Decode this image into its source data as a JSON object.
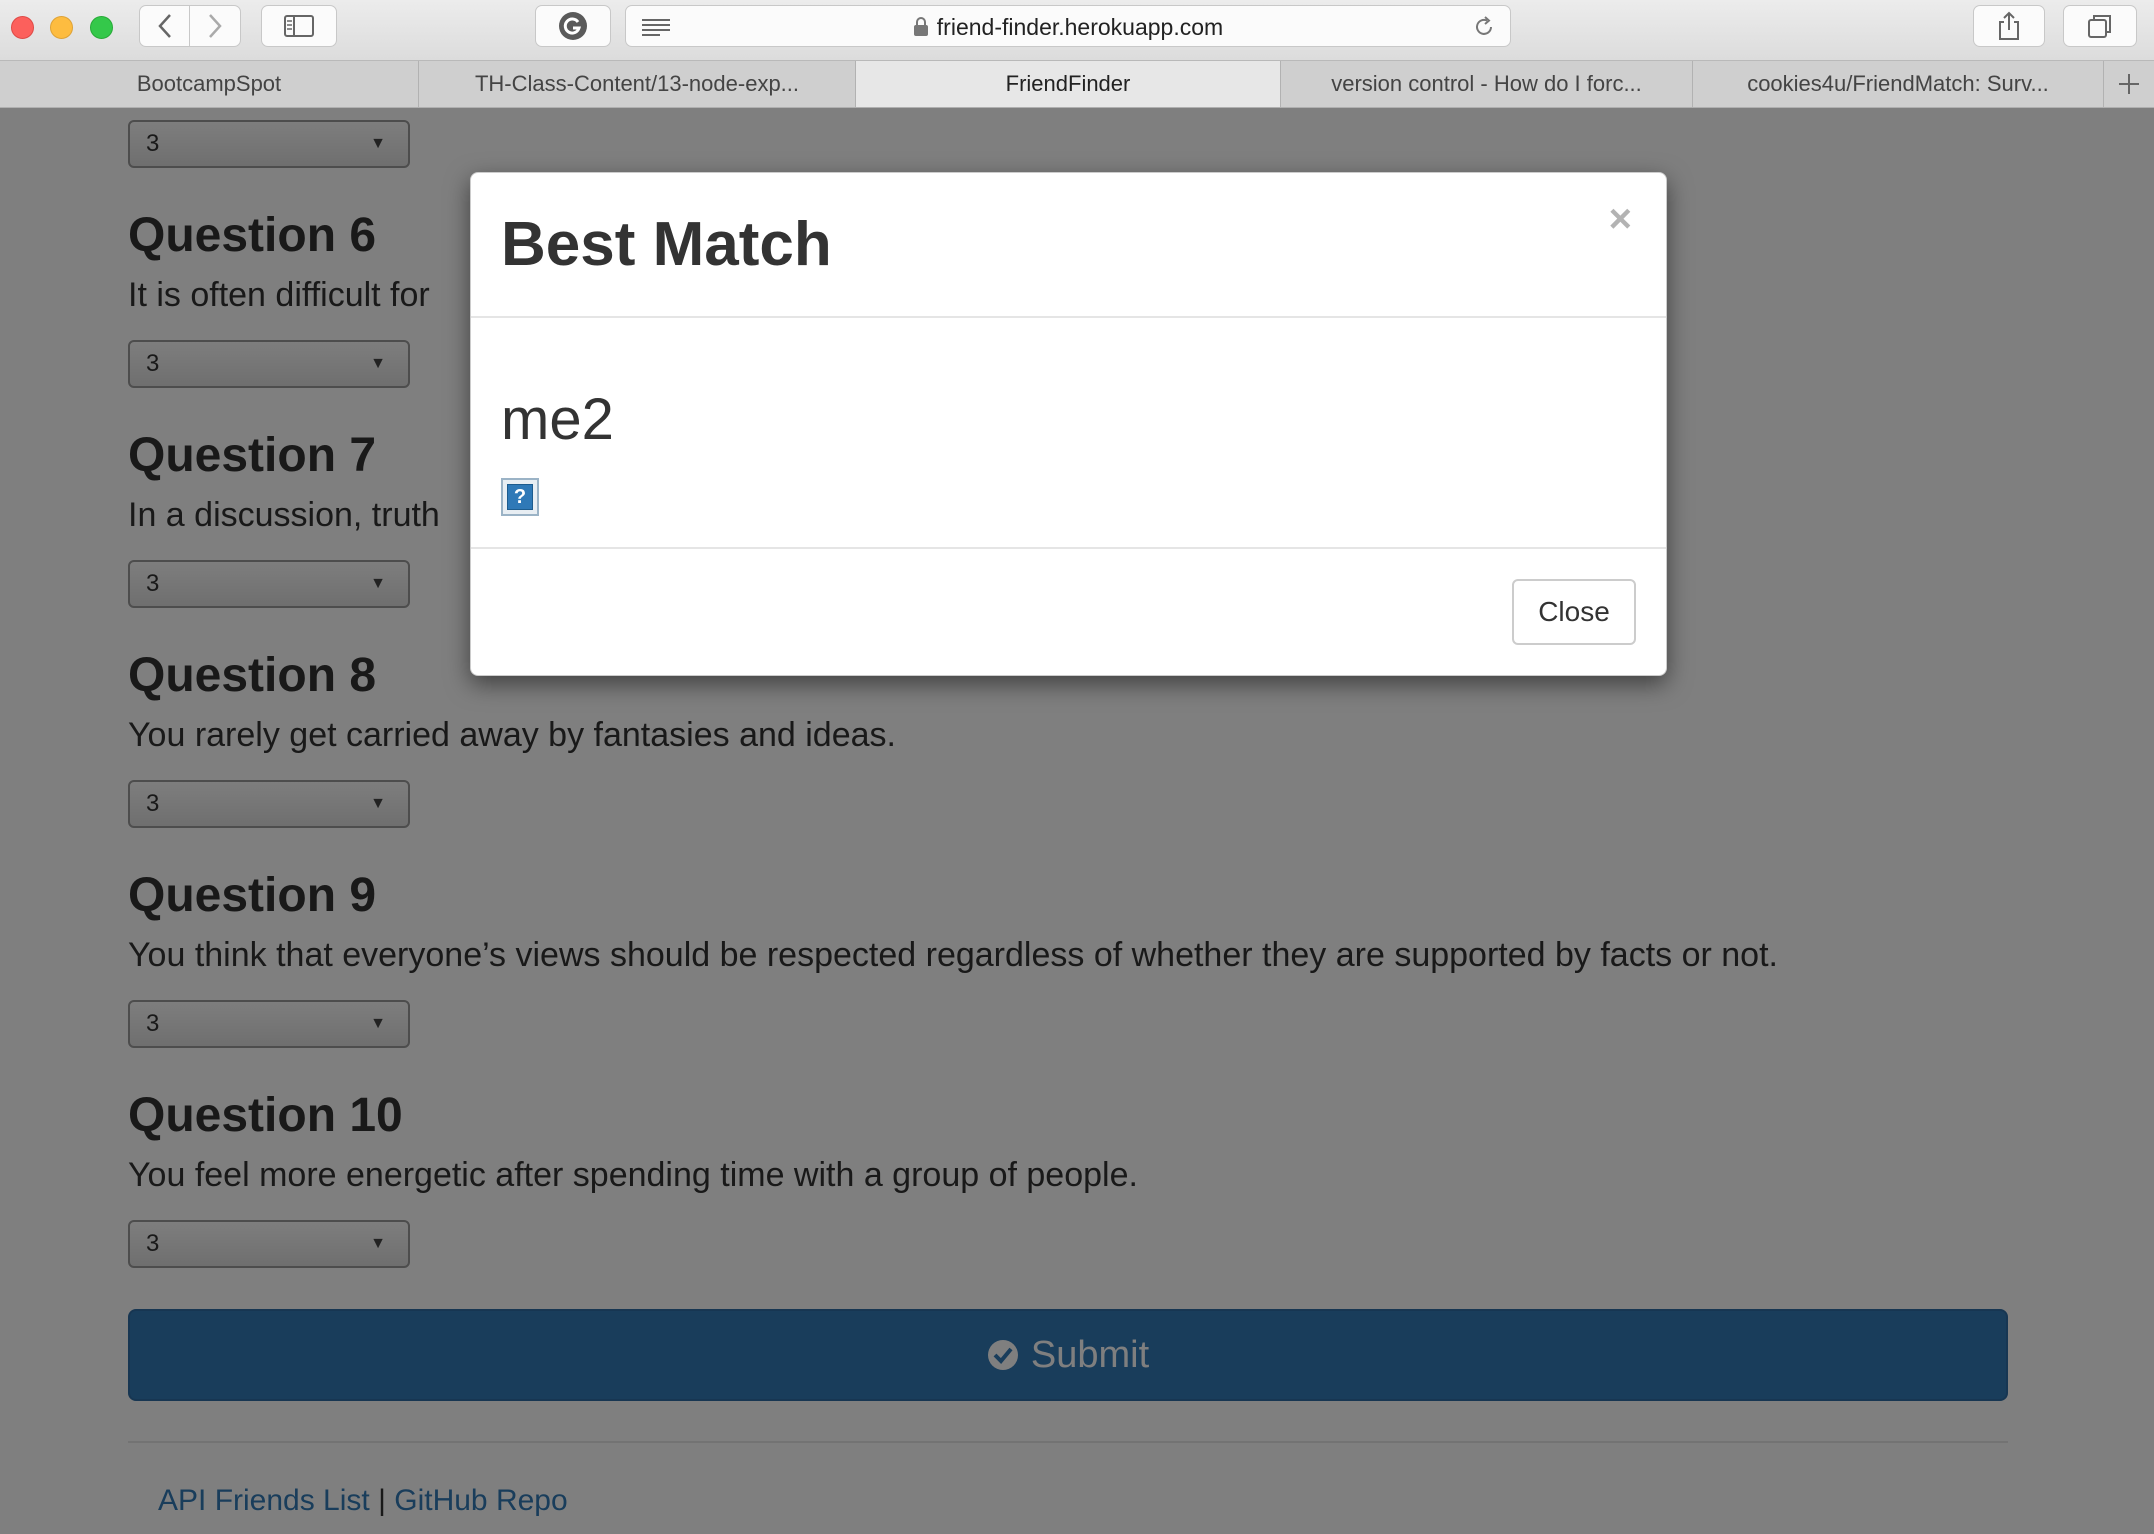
{
  "browser": {
    "url": "friend-finder.herokuapp.com",
    "tabs": [
      {
        "label": "BootcampSpot",
        "active": false
      },
      {
        "label": "TH-Class-Content/13-node-exp...",
        "active": false
      },
      {
        "label": "FriendFinder",
        "active": true
      },
      {
        "label": "version control - How do I forc...",
        "active": false
      },
      {
        "label": "cookies4u/FriendMatch: Surv...",
        "active": false
      }
    ]
  },
  "survey": {
    "questions": [
      {
        "title": "Question 6",
        "text": "It is often difficult for",
        "answer": "3"
      },
      {
        "title": "Question 7",
        "text": "In a discussion, truth",
        "answer": "3"
      },
      {
        "title": "Question 8",
        "text": "You rarely get carried away by fantasies and ideas.",
        "answer": "3"
      },
      {
        "title": "Question 9",
        "text": "You think that everyone’s views should be respected regardless of whether they are supported by facts or not.",
        "answer": "3"
      },
      {
        "title": "Question 10",
        "text": "You feel more energetic after spending time with a group of people.",
        "answer": "3"
      }
    ],
    "prev_answer": "3",
    "submit_label": "Submit"
  },
  "footer": {
    "api_link": "API Friends List",
    "separator": "|",
    "github_link": "GitHub Repo"
  },
  "modal": {
    "title": "Best Match",
    "close_x": "×",
    "match_name": "me2",
    "broken_image_glyph": "?",
    "close_label": "Close"
  },
  "colors": {
    "primary": "#337ab7",
    "backdrop": "rgba(0,0,0,0.5)"
  }
}
